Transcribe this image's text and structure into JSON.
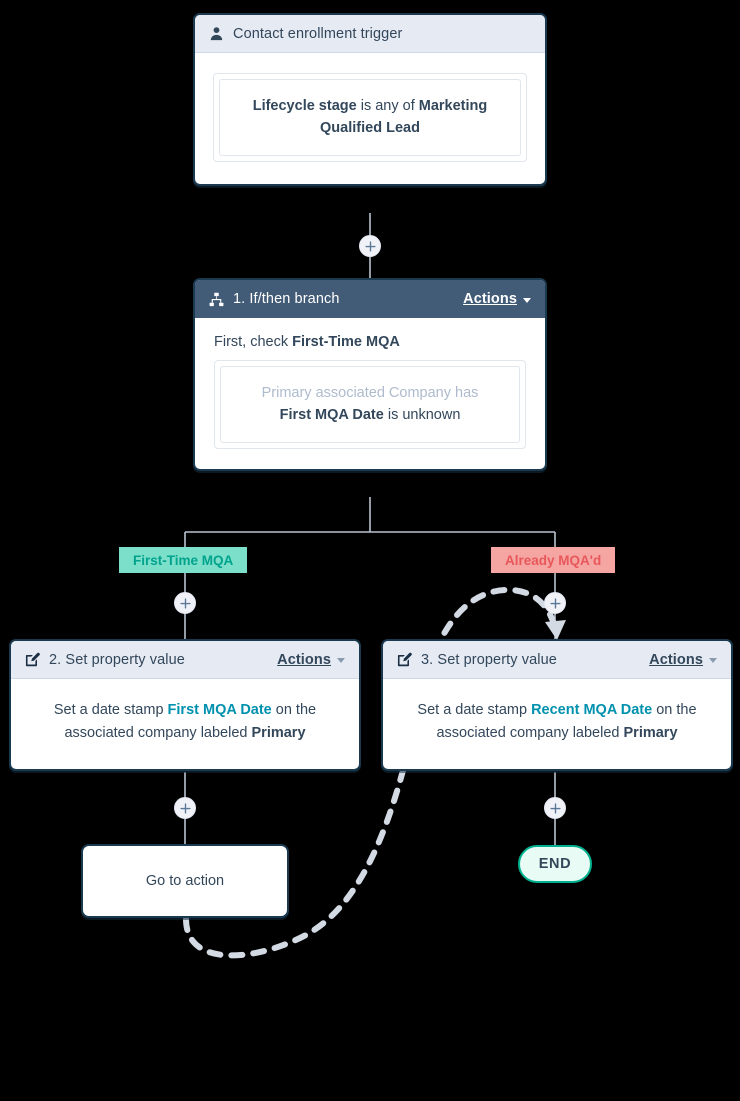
{
  "workflow": {
    "trigger": {
      "icon": "contact-person-icon",
      "title": "Contact enrollment trigger",
      "condition": {
        "prefix": "",
        "property": "Lifecycle stage",
        "operator": " is any of ",
        "value": "Marketing Qualified Lead"
      }
    },
    "branch": {
      "icon": "sitemap-branch-icon",
      "title": "1. If/then branch",
      "actions_label": "Actions",
      "check_prefix": "First, check ",
      "check_name": "First-Time MQA",
      "condition": {
        "muted_line": "Primary associated Company has",
        "property": "First MQA Date",
        "operator": " is unknown"
      },
      "labels": {
        "yes": "First-Time MQA",
        "no": "Already MQA'd"
      }
    },
    "action_left": {
      "icon": "edit-square-icon",
      "title": "2. Set property value",
      "actions_label": "Actions",
      "text_before": "Set a date stamp ",
      "property": "First MQA Date",
      "text_middle": " on the associated company labeled ",
      "text_bold": "Primary"
    },
    "action_right": {
      "icon": "edit-square-icon",
      "title": "3. Set property value",
      "actions_label": "Actions",
      "text_before": "Set a date stamp ",
      "property": "Recent MQA Date",
      "text_middle": " on the associated company labeled ",
      "text_bold": "Primary"
    },
    "goto": {
      "label": "Go to action"
    },
    "end": {
      "label": "END"
    },
    "add_buttons": [
      {
        "name": "add-step-after-trigger"
      },
      {
        "name": "add-step-left-branch"
      },
      {
        "name": "add-step-right-branch"
      },
      {
        "name": "add-step-after-action-2"
      },
      {
        "name": "add-step-after-action-3"
      }
    ],
    "colors": {
      "header_dark": "#425b77",
      "header_light": "#e5eaf3",
      "card_border": "#1b3a4f",
      "property_link": "#0091ae",
      "label_yes_bg": "#7bdfc9",
      "label_yes_text": "#00a38d",
      "label_no_bg": "#f5a6a3",
      "label_no_text": "#e8575a",
      "end_bg": "#e8fbf4",
      "end_border": "#00b18f",
      "connector": "#b9c3d1",
      "plus_bg": "#f0f2f8",
      "text": "#33475b",
      "muted_text": "#aebbcd"
    }
  }
}
